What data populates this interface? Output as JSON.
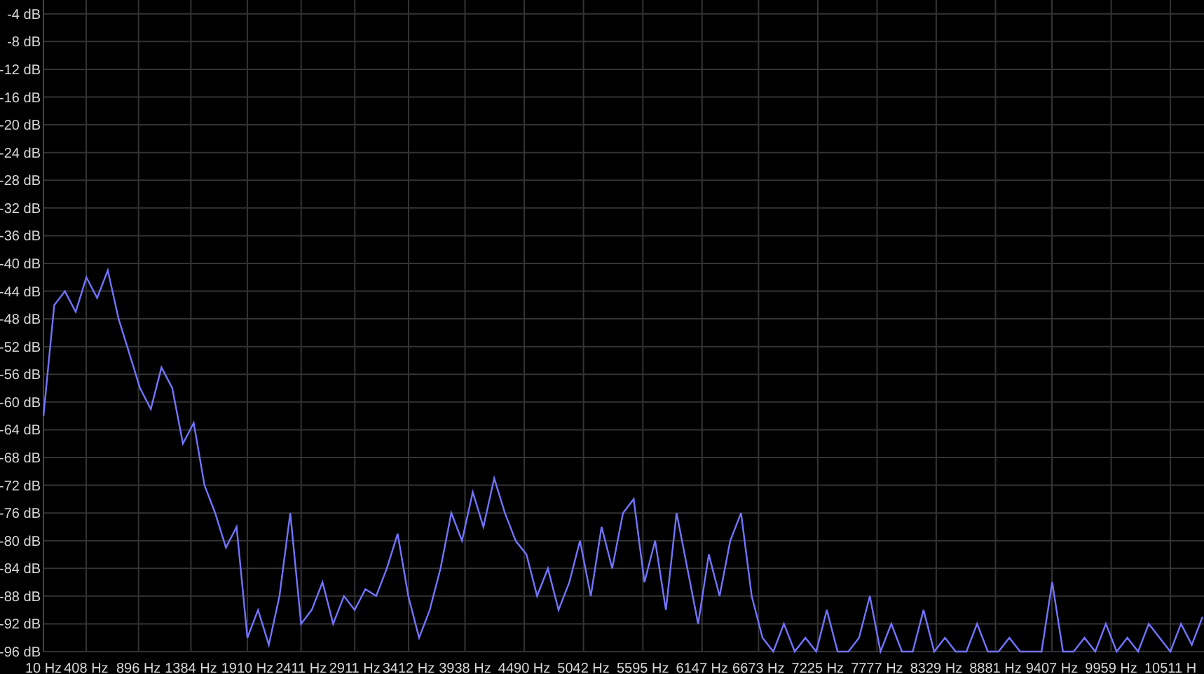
{
  "chart_data": {
    "type": "line",
    "grid": true,
    "ylim": [
      -96,
      -2
    ],
    "xlim": [
      10,
      10824
    ],
    "yticks": [
      {
        "value": -4,
        "label": "-4 dB"
      },
      {
        "value": -8,
        "label": "-8 dB"
      },
      {
        "value": -12,
        "label": "-12 dB"
      },
      {
        "value": -16,
        "label": "-16 dB"
      },
      {
        "value": -20,
        "label": "-20 dB"
      },
      {
        "value": -24,
        "label": "-24 dB"
      },
      {
        "value": -28,
        "label": "-28 dB"
      },
      {
        "value": -32,
        "label": "-32 dB"
      },
      {
        "value": -36,
        "label": "-36 dB"
      },
      {
        "value": -40,
        "label": "-40 dB"
      },
      {
        "value": -44,
        "label": "-44 dB"
      },
      {
        "value": -48,
        "label": "-48 dB"
      },
      {
        "value": -52,
        "label": "-52 dB"
      },
      {
        "value": -56,
        "label": "-56 dB"
      },
      {
        "value": -60,
        "label": "-60 dB"
      },
      {
        "value": -64,
        "label": "-64 dB"
      },
      {
        "value": -68,
        "label": "-68 dB"
      },
      {
        "value": -72,
        "label": "-72 dB"
      },
      {
        "value": -76,
        "label": "-76 dB"
      },
      {
        "value": -80,
        "label": "-80 dB"
      },
      {
        "value": -84,
        "label": "-84 dB"
      },
      {
        "value": -88,
        "label": "-88 dB"
      },
      {
        "value": -92,
        "label": "-92 dB"
      },
      {
        "value": -96,
        "label": "-96 dB"
      }
    ],
    "xticks": [
      {
        "value": 10,
        "label": "10 Hz"
      },
      {
        "value": 408,
        "label": "408 Hz"
      },
      {
        "value": 896,
        "label": "896 Hz"
      },
      {
        "value": 1384,
        "label": "1384 Hz"
      },
      {
        "value": 1910,
        "label": "1910 Hz"
      },
      {
        "value": 2411,
        "label": "2411 Hz"
      },
      {
        "value": 2911,
        "label": "2911 Hz"
      },
      {
        "value": 3412,
        "label": "3412 Hz"
      },
      {
        "value": 3938,
        "label": "3938 Hz"
      },
      {
        "value": 4490,
        "label": "4490 Hz"
      },
      {
        "value": 5042,
        "label": "5042 Hz"
      },
      {
        "value": 5595,
        "label": "5595 Hz"
      },
      {
        "value": 6147,
        "label": "6147 Hz"
      },
      {
        "value": 6673,
        "label": "6673 Hz"
      },
      {
        "value": 7225,
        "label": "7225 Hz"
      },
      {
        "value": 7777,
        "label": "7777 Hz"
      },
      {
        "value": 8329,
        "label": "8329 Hz"
      },
      {
        "value": 8881,
        "label": "8881 Hz"
      },
      {
        "value": 9407,
        "label": "9407 Hz"
      },
      {
        "value": 9959,
        "label": "9959 Hz"
      },
      {
        "value": 10511,
        "label": "10511 H"
      }
    ],
    "x": [
      10,
      110,
      210,
      310,
      410,
      510,
      610,
      710,
      810,
      910,
      1010,
      1110,
      1210,
      1310,
      1410,
      1510,
      1610,
      1710,
      1810,
      1910,
      2010,
      2110,
      2210,
      2310,
      2410,
      2510,
      2610,
      2710,
      2810,
      2910,
      3010,
      3110,
      3210,
      3310,
      3410,
      3510,
      3610,
      3710,
      3810,
      3910,
      4010,
      4110,
      4210,
      4310,
      4410,
      4510,
      4610,
      4710,
      4810,
      4910,
      5010,
      5110,
      5210,
      5310,
      5410,
      5510,
      5610,
      5710,
      5810,
      5910,
      6010,
      6110,
      6210,
      6310,
      6410,
      6510,
      6610,
      6710,
      6810,
      6910,
      7010,
      7110,
      7210,
      7310,
      7410,
      7510,
      7610,
      7710,
      7810,
      7910,
      8010,
      8110,
      8210,
      8310,
      8410,
      8510,
      8610,
      8710,
      8810,
      8910,
      9010,
      9110,
      9210,
      9310,
      9410,
      9510,
      9610,
      9710,
      9810,
      9910,
      10010,
      10110,
      10210,
      10310,
      10410,
      10510,
      10610,
      10710,
      10810
    ],
    "series": [
      {
        "color": "#7373ff",
        "values": [
          -62,
          -46,
          -44,
          -47,
          -42,
          -45,
          -41,
          -48,
          -53,
          -58,
          -61,
          -55,
          -58,
          -66,
          -63,
          -72,
          -76,
          -81,
          -78,
          -94,
          -90,
          -95,
          -88,
          -76,
          -92,
          -90,
          -86,
          -92,
          -88,
          -90,
          -87,
          -88,
          -84,
          -79,
          -88,
          -94,
          -90,
          -84,
          -76,
          -80,
          -73,
          -78,
          -71,
          -76,
          -80,
          -82,
          -88,
          -84,
          -90,
          -86,
          -80,
          -88,
          -78,
          -84,
          -76,
          -74,
          -86,
          -80,
          -90,
          -76,
          -84,
          -92,
          -82,
          -88,
          -80,
          -76,
          -88,
          -94,
          -96,
          -92,
          -96,
          -94,
          -96,
          -90,
          -96,
          -96,
          -94,
          -88,
          -96,
          -92,
          -96,
          -96,
          -90,
          -96,
          -94,
          -96,
          -96,
          -92,
          -96,
          -96,
          -94,
          -96,
          -96,
          -96,
          -86,
          -96,
          -96,
          -94,
          -96,
          -92,
          -96,
          -94,
          -96,
          -92,
          -94,
          -96,
          -92,
          -95,
          -91
        ]
      }
    ]
  }
}
